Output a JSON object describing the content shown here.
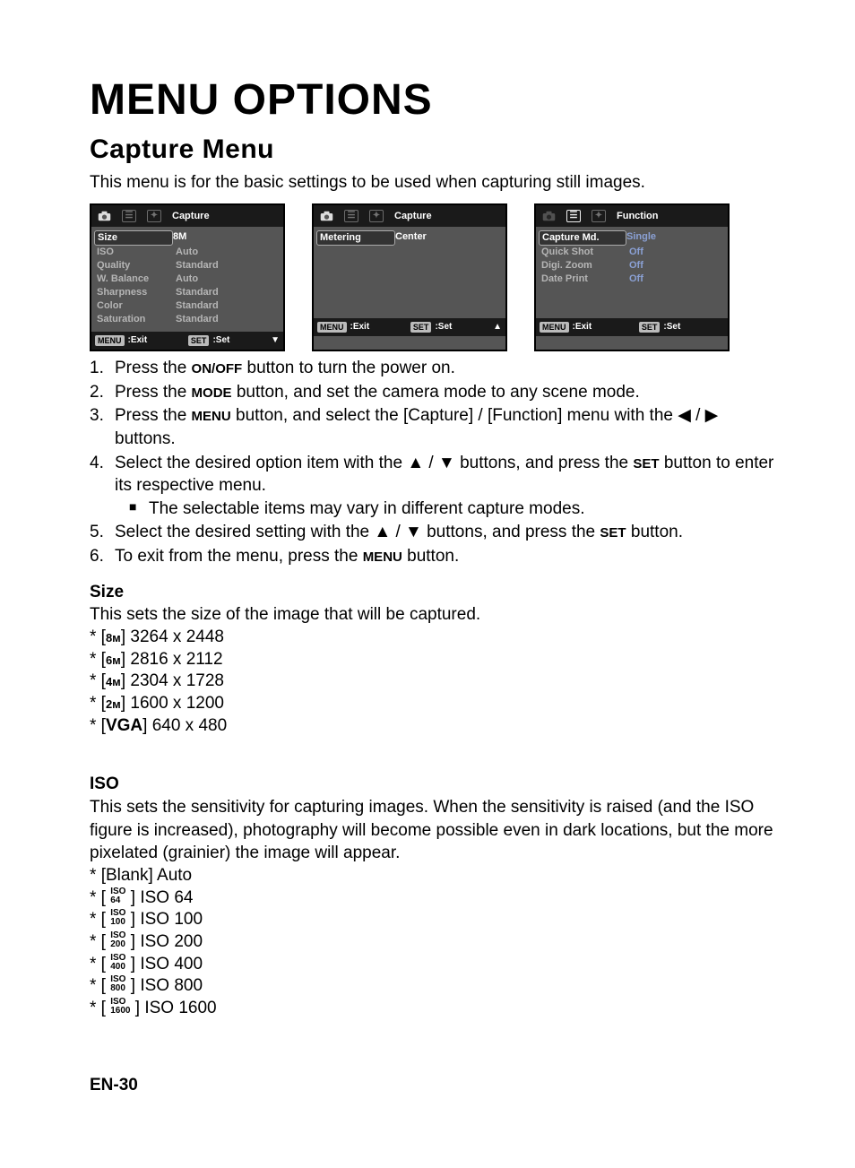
{
  "heading1": "MENU OPTIONS",
  "heading2": "Capture Menu",
  "intro": "This menu is for the basic settings to be used when capturing still images.",
  "screens": {
    "a": {
      "title": "Capture",
      "rows": [
        {
          "label": "Size",
          "value": "8M",
          "sel": true
        },
        {
          "label": "ISO",
          "value": "Auto"
        },
        {
          "label": "Quality",
          "value": "Standard"
        },
        {
          "label": "W. Balance",
          "value": "Auto"
        },
        {
          "label": "Sharpness",
          "value": "Standard"
        },
        {
          "label": "Color",
          "value": "Standard"
        },
        {
          "label": "Saturation",
          "value": "Standard"
        }
      ],
      "foot": {
        "menu": "MENU",
        "exit": ":Exit",
        "set": "SET",
        "setlabel": ":Set",
        "arrow": "▼"
      }
    },
    "b": {
      "title": "Capture",
      "rows": [
        {
          "label": "Metering",
          "value": "Center",
          "sel": true
        }
      ],
      "foot": {
        "menu": "MENU",
        "exit": ":Exit",
        "set": "SET",
        "setlabel": ":Set",
        "arrow": "▲"
      }
    },
    "c": {
      "title": "Function",
      "rows": [
        {
          "label": "Capture Md.",
          "value": "Single",
          "sel": true
        },
        {
          "label": "Quick Shot",
          "value": "Off"
        },
        {
          "label": "Digi. Zoom",
          "value": "Off"
        },
        {
          "label": "Date Print",
          "value": "Off"
        }
      ],
      "foot": {
        "menu": "MENU",
        "exit": ":Exit",
        "set": "SET",
        "setlabel": ":Set",
        "arrow": ""
      }
    }
  },
  "steps": [
    {
      "num": "1.",
      "pre": "Press the ",
      "btn": "ON/OFF",
      "post": " button to turn the power on."
    },
    {
      "num": "2.",
      "pre": "Press the ",
      "btn": "MODE",
      "post": " button, and set the camera mode to any scene mode."
    },
    {
      "num": "3.",
      "pre": "Press the ",
      "btn": "MENU",
      "post": " button, and select the [Capture] / [Function] menu with the ◀ / ▶ buttons."
    },
    {
      "num": "4.",
      "pre": "Select the desired option item with the ▲ / ▼ buttons, and press the ",
      "btn": "SET",
      "post": " button to enter its respective menu.",
      "sub": "The selectable items may vary in different capture modes."
    },
    {
      "num": "5.",
      "pre": "Select the desired setting with the ▲ / ▼ buttons, and press the ",
      "btn": "SET",
      "post": " button."
    },
    {
      "num": "6.",
      "pre": "To exit from the menu, press the ",
      "btn": "MENU",
      "post": " button."
    }
  ],
  "size": {
    "heading": "Size",
    "desc": "This sets the size of the image that will be captured.",
    "items": [
      {
        "icon": "8ᴍ",
        "val": "3264 x 2448"
      },
      {
        "icon": "6ᴍ",
        "val": "2816 x 2112"
      },
      {
        "icon": "4ᴍ",
        "val": "2304 x 1728"
      },
      {
        "icon": "2ᴍ",
        "val": "1600 x 1200"
      },
      {
        "icon": "VGA",
        "val": "640 x 480"
      }
    ]
  },
  "iso": {
    "heading": "ISO",
    "desc": "This sets the sensitivity for capturing images. When the sensitivity is raised (and the ISO figure is increased), photography will become possible even in dark locations, but the more pixelated (grainier) the image will appear.",
    "items": [
      {
        "icon": "[Blank]",
        "val": "Auto",
        "plain": true
      },
      {
        "icon": "ISO 64",
        "val": "ISO  64"
      },
      {
        "icon": "ISO 100",
        "val": "ISO 100"
      },
      {
        "icon": "ISO 200",
        "val": "ISO 200"
      },
      {
        "icon": "ISO 400",
        "val": "ISO 400"
      },
      {
        "icon": "ISO 800",
        "val": "ISO 800"
      },
      {
        "icon": "ISO 1600",
        "val": "ISO 1600"
      }
    ]
  },
  "footer": "EN-30"
}
